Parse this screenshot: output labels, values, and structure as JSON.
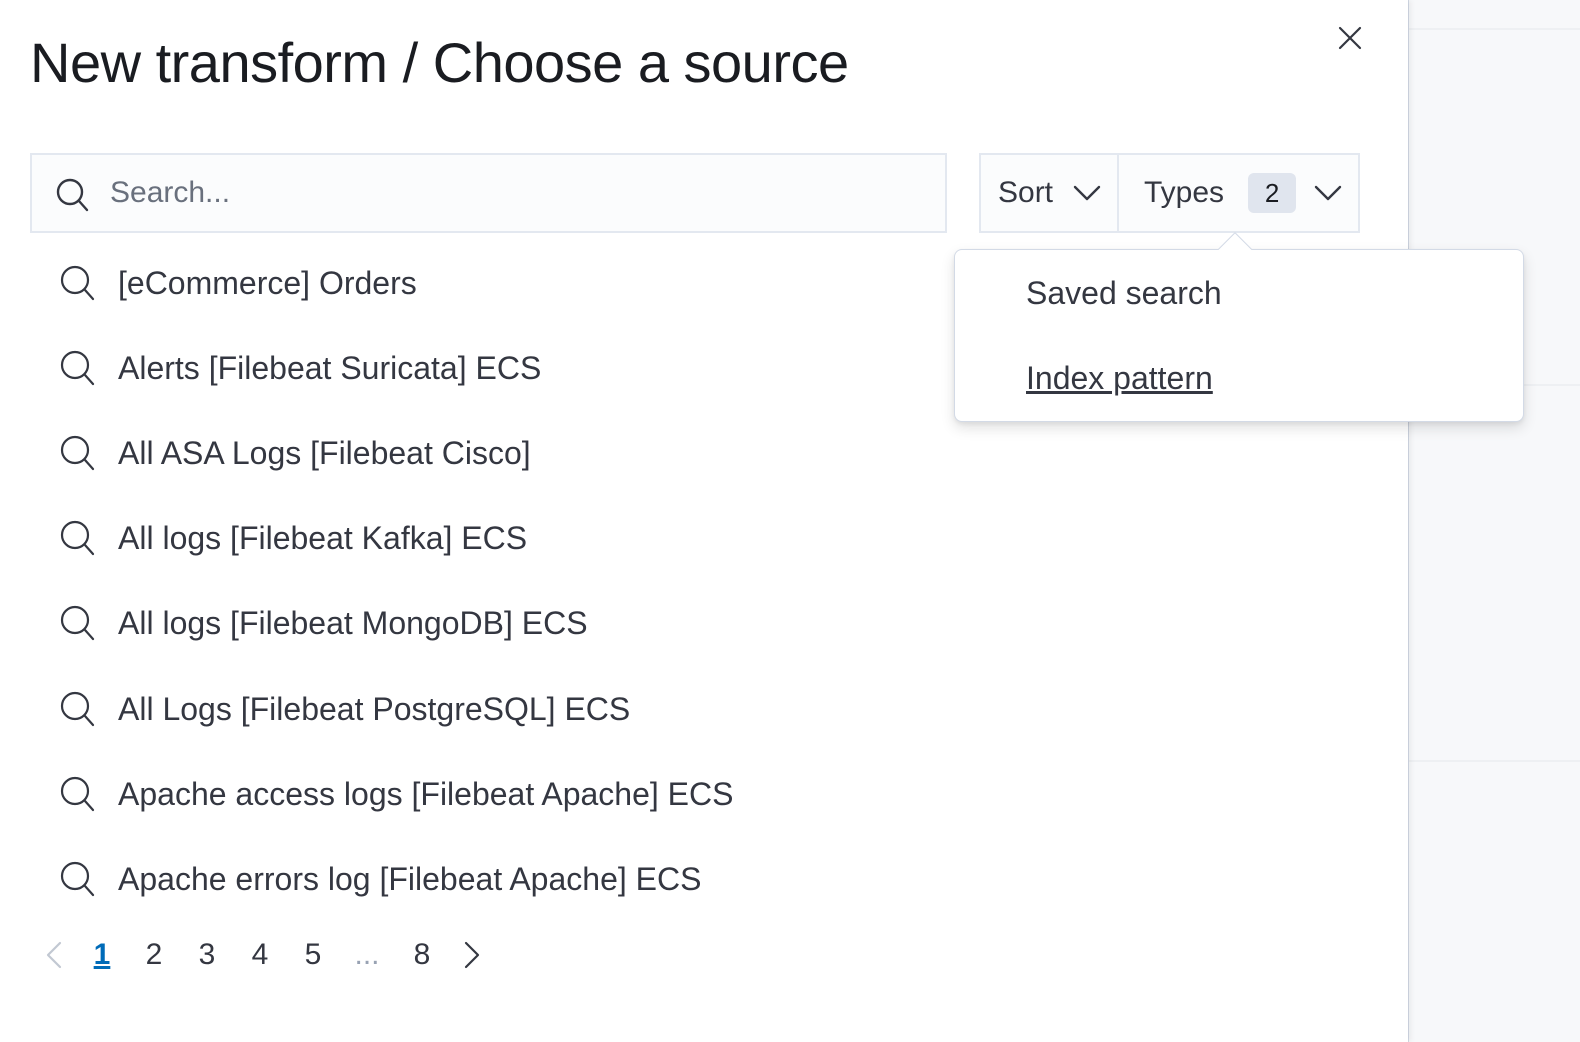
{
  "flyout": {
    "title": "New transform / Choose a source"
  },
  "search": {
    "placeholder": "Search...",
    "value": ""
  },
  "filters": {
    "sort_label": "Sort",
    "types_label": "Types",
    "types_count": "2"
  },
  "types_popover": {
    "options": [
      {
        "label": "Saved search",
        "focused": false
      },
      {
        "label": "Index pattern",
        "focused": true
      }
    ]
  },
  "results": [
    {
      "label": "[eCommerce] Orders",
      "icon": "search-icon"
    },
    {
      "label": "Alerts [Filebeat Suricata] ECS",
      "icon": "search-icon"
    },
    {
      "label": "All ASA Logs [Filebeat Cisco]",
      "icon": "search-icon"
    },
    {
      "label": "All logs [Filebeat Kafka] ECS",
      "icon": "search-icon"
    },
    {
      "label": "All logs [Filebeat MongoDB] ECS",
      "icon": "search-icon"
    },
    {
      "label": "All Logs [Filebeat PostgreSQL] ECS",
      "icon": "search-icon"
    },
    {
      "label": "Apache access logs [Filebeat Apache] ECS",
      "icon": "search-icon"
    },
    {
      "label": "Apache errors log [Filebeat Apache] ECS",
      "icon": "search-icon"
    }
  ],
  "pagination": {
    "pages": [
      "1",
      "2",
      "3",
      "4",
      "5",
      "...",
      "8"
    ],
    "current": "1"
  },
  "colors": {
    "accent": "#006bb8",
    "text": "#343741",
    "border": "#e3e8f0",
    "badge": "#e0e5ee"
  }
}
